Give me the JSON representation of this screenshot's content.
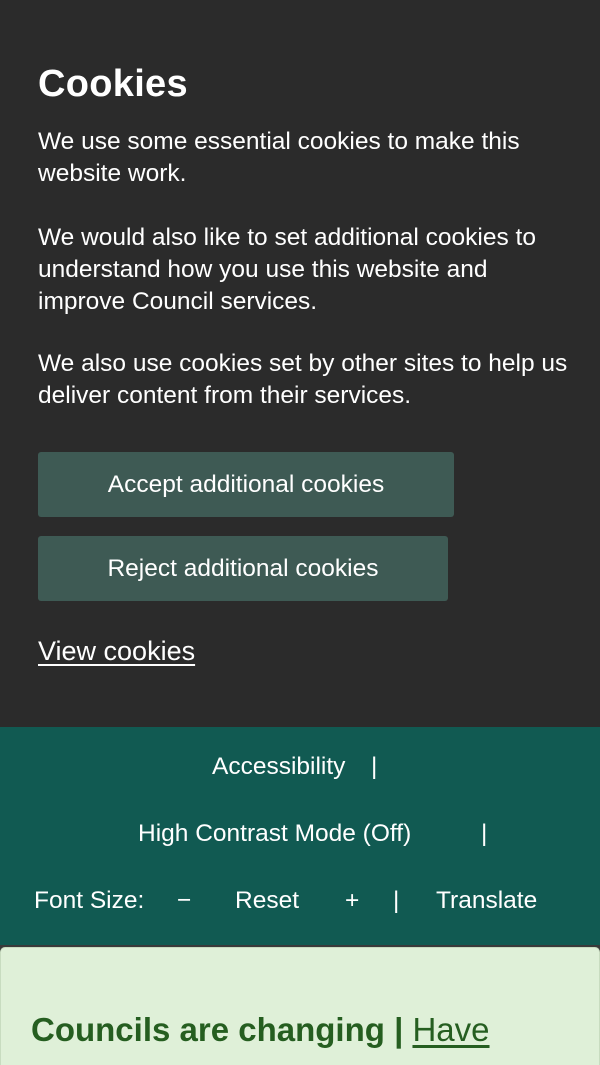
{
  "cookie_banner": {
    "title": "Cookies",
    "paragraphs": [
      "We use some essential cookies to make this website work.",
      "We would also like to set additional cookies to understand how you use this website and improve Council services.",
      "We also use cookies set by other sites to help us deliver content from their services."
    ],
    "accept_label": "Accept additional cookies",
    "reject_label": "Reject additional cookies",
    "view_cookies_label": "View cookies"
  },
  "accessibility_toolbar": {
    "accessibility_label": "Accessibility",
    "separator": "|",
    "high_contrast_label": "High Contrast Mode (Off)",
    "font_size_label": "Font Size:",
    "decrease_label": "−",
    "reset_label": "Reset",
    "increase_label": "+",
    "translate_label": "Translate"
  },
  "notice_banner": {
    "text": "Councils are changing | ",
    "link_label": "Have"
  },
  "colors": {
    "cookie_background": "#2b2b2b",
    "button_background": "#3e5a54",
    "toolbar_background": "#115a52",
    "notice_background": "#dff0d8",
    "notice_text": "#255e20"
  }
}
